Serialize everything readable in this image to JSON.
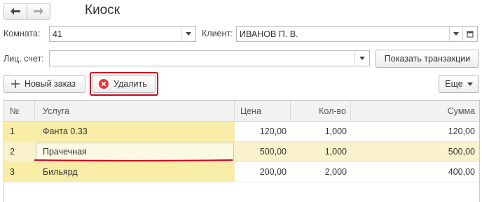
{
  "window": {
    "title": "Киоск"
  },
  "form": {
    "room_label": "Комната:",
    "room_value": "41",
    "client_label": "Клиент:",
    "client_value": "ИВАНОВ П. В.",
    "account_label": "Лиц. счет:",
    "account_value": "",
    "show_transactions_label": "Показать транзакции"
  },
  "toolbar": {
    "new_order_label": "Новый заказ",
    "delete_label": "Удалить",
    "more_label": "Еще"
  },
  "table": {
    "columns": [
      "№",
      "Услуга",
      "Цена",
      "Кол-во",
      "Сумма"
    ],
    "rows": [
      {
        "num": "1",
        "service": "Фанта 0.33",
        "price": "120,00",
        "qty": "1,000",
        "sum": "120,00"
      },
      {
        "num": "2",
        "service": "Прачечная",
        "price": "500,00",
        "qty": "1,000",
        "sum": "500,00"
      },
      {
        "num": "3",
        "service": "Бильярд",
        "price": "200,00",
        "qty": "2,000",
        "sum": "400,00"
      }
    ]
  },
  "colors": {
    "highlight_red": "#d0021b",
    "row_highlight": "#f8eda6",
    "delete_icon": "#e03a3a"
  },
  "icons": {
    "back": "arrow-left-icon",
    "forward": "arrow-right-icon",
    "dropdown": "chevron-down-icon",
    "open": "open-form-icon",
    "add": "plus-icon",
    "delete": "delete-x-icon"
  }
}
